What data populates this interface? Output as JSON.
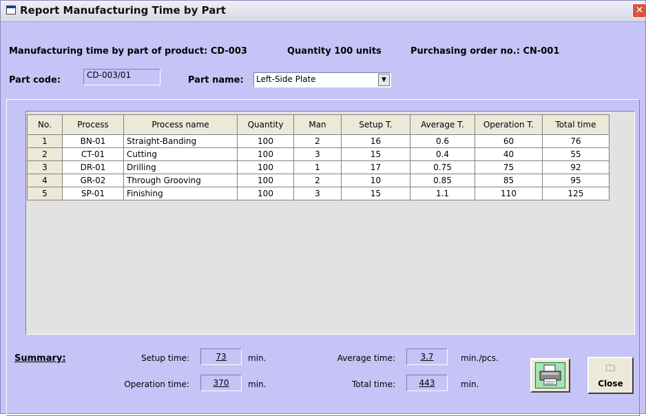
{
  "window": {
    "title": "Report Manufacturing Time by Part"
  },
  "header": {
    "product_label": "Manufacturing time by part of product: CD-003",
    "quantity_label": "Quantity 100 units",
    "order_label": "Purchasing order no.: CN-001"
  },
  "form": {
    "part_code_label": "Part code:",
    "part_code_value": "CD-003/01",
    "part_name_label": "Part name:",
    "part_name_value": "Left-Side Plate"
  },
  "table": {
    "columns": [
      "No.",
      "Process",
      "Process name",
      "Quantity",
      "Man",
      "Setup T.",
      "Average T.",
      "Operation T.",
      "Total time"
    ],
    "rows": [
      [
        "1",
        "BN-01",
        "Straight-Banding",
        "100",
        "2",
        "16",
        "0.6",
        "60",
        "76"
      ],
      [
        "2",
        "CT-01",
        "Cutting",
        "100",
        "3",
        "15",
        "0.4",
        "40",
        "55"
      ],
      [
        "3",
        "DR-01",
        "Drilling",
        "100",
        "1",
        "17",
        "0.75",
        "75",
        "92"
      ],
      [
        "4",
        "GR-02",
        "Through Grooving",
        "100",
        "2",
        "10",
        "0.85",
        "85",
        "95"
      ],
      [
        "5",
        "SP-01",
        "Finishing",
        "100",
        "3",
        "15",
        "1.1",
        "110",
        "125"
      ]
    ]
  },
  "summary": {
    "title": "Summary:",
    "setup_label": "Setup time:",
    "setup_value": "73",
    "setup_unit": "min.",
    "average_label": "Average time:",
    "average_value": "3.7",
    "average_unit": "min./pcs.",
    "operation_label": "Operation time:",
    "operation_value": "370",
    "operation_unit": "min.",
    "total_label": "Total time:",
    "total_value": "443",
    "total_unit": "min."
  },
  "buttons": {
    "close_label": "Close"
  },
  "icons": {
    "window": "window-icon",
    "print": "printer-icon",
    "close": "folder-icon"
  }
}
